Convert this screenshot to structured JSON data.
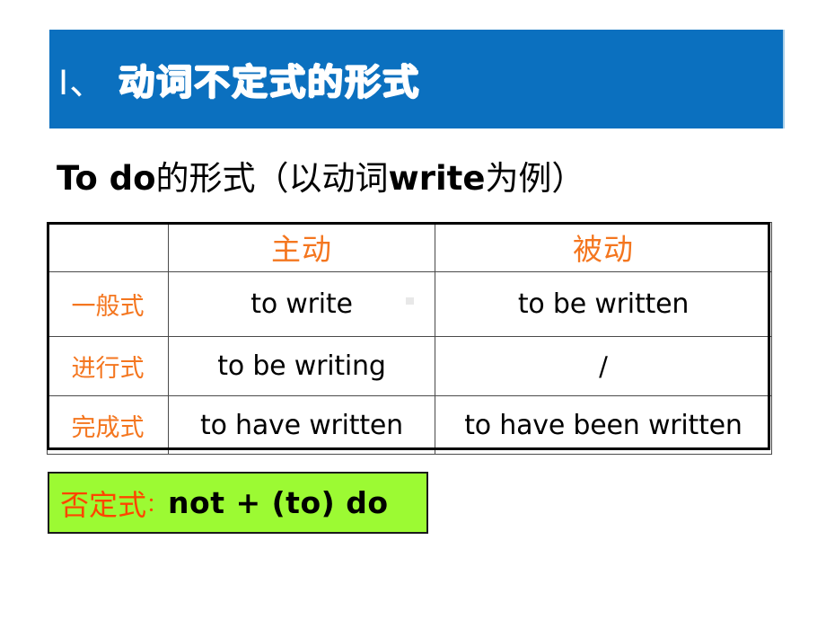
{
  "slide": {
    "title": {
      "numeral": "I、",
      "heading": "动词不定式的形式",
      "background_color": "#0B70BF",
      "text_color": "#FFFFFF"
    },
    "subtitle": {
      "english_part": "To do",
      "chinese_part": "的形式（以动词",
      "english_inline": "write",
      "chinese_tail": "为例）",
      "full": "To do的形式（以动词write为例）"
    },
    "table": {
      "accent_color": "#F4761F",
      "columns": [
        "",
        "主动",
        "被动"
      ],
      "rows": [
        {
          "label": "一般式",
          "active": "to write",
          "passive": "to be written"
        },
        {
          "label": "进行式",
          "active": "to be writing",
          "passive": "/"
        },
        {
          "label": "完成式",
          "active": "to have written",
          "passive": "to have been written"
        }
      ]
    },
    "negative_box": {
      "label": "否定式",
      "colon": "：",
      "formula": "not + (to) do",
      "background_color": "#9CFA33",
      "label_color": "#FF4500",
      "formula_color": "#000000"
    }
  }
}
